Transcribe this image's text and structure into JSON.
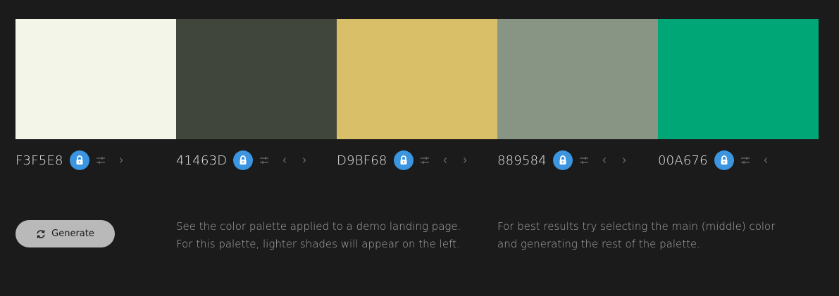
{
  "palette": [
    {
      "hex": "F3F5E8",
      "color": "#F3F5E8",
      "arrows": [
        "right"
      ]
    },
    {
      "hex": "41463D",
      "color": "#41463D",
      "arrows": [
        "left",
        "right"
      ]
    },
    {
      "hex": "D9BF68",
      "color": "#D9BF68",
      "arrows": [
        "left",
        "right"
      ]
    },
    {
      "hex": "889584",
      "color": "#889584",
      "arrows": [
        "left",
        "right"
      ]
    },
    {
      "hex": "00A676",
      "color": "#00A676",
      "arrows": [
        "left"
      ]
    }
  ],
  "icons": {
    "lock": "lock-icon",
    "adjust": "sliders-icon",
    "left": "chevron-left-icon",
    "right": "chevron-right-icon",
    "generate": "refresh-icon"
  },
  "colors": {
    "background": "#1b1b1b",
    "lock_button": "#3b95e0",
    "generate_button": "#b9b9b9"
  },
  "generate": {
    "label": "Generate"
  },
  "info_demo": {
    "line1": "See the color palette applied to a demo landing page.",
    "line2": "For this palette, lighter shades will appear on the left."
  },
  "info_tip": {
    "line1": "For best results try selecting the main (middle) color",
    "line2": "and generating the rest of the palette."
  }
}
